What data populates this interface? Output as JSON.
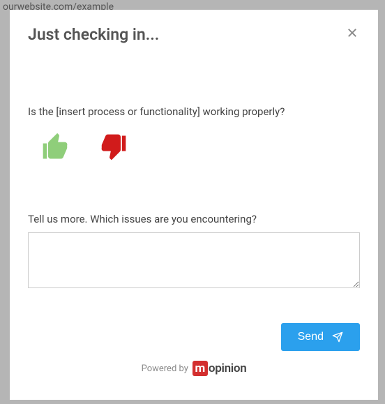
{
  "urlBar": "ourwebsite.com/example",
  "modal": {
    "title": "Just checking in...",
    "question1": "Is the [insert process or functionality] working properly?",
    "question2": "Tell us more. Which issues are you encountering?",
    "sendLabel": "Send",
    "poweredBy": "Powered by",
    "brand": "opinion"
  }
}
